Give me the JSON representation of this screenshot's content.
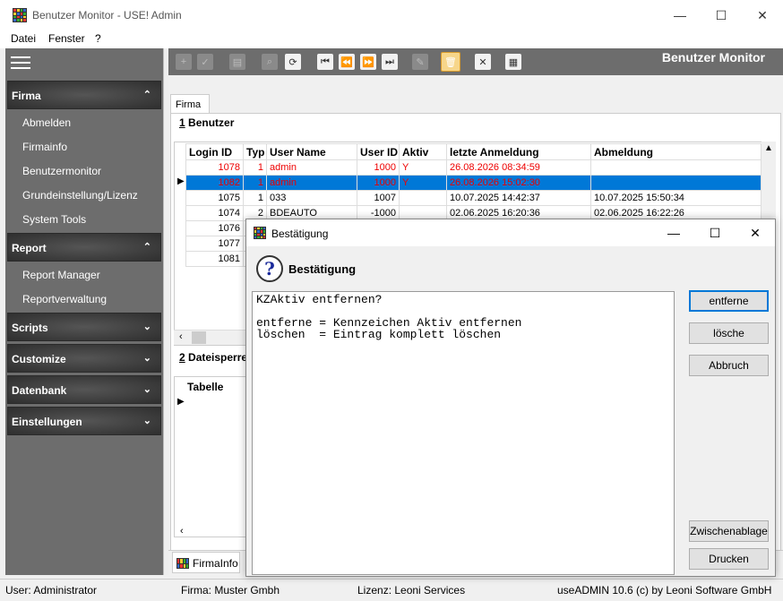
{
  "window": {
    "title": "Benutzer Monitor - USE! Admin",
    "min": "—",
    "max": "☐",
    "close": "✕"
  },
  "menu": [
    "Datei",
    "Fenster",
    "?"
  ],
  "sidebar": {
    "sections": [
      {
        "label": "Firma",
        "chev": "⌃",
        "items": [
          "Abmelden",
          "Firmainfo",
          "Benutzermonitor",
          "Grundeinstellung/Lizenz",
          "System Tools"
        ]
      },
      {
        "label": "Report",
        "chev": "⌃",
        "items": [
          "Report Manager",
          "Reportverwaltung"
        ]
      },
      {
        "label": "Scripts",
        "chev": "⌄",
        "items": []
      },
      {
        "label": "Customize",
        "chev": "⌄",
        "items": []
      },
      {
        "label": "Datenbank",
        "chev": "⌄",
        "items": []
      },
      {
        "label": "Einstellungen",
        "chev": "⌄",
        "items": []
      }
    ]
  },
  "toolbar": {
    "title": "Benutzer Monitor"
  },
  "tabs": {
    "firma": "Firma",
    "firmainfo": "FirmaInfo"
  },
  "group1": {
    "num": "1",
    "label": " Benutzer"
  },
  "group2": {
    "num": "2",
    "label": " Dateisperre"
  },
  "users": {
    "columns": [
      "Login ID",
      "Typ",
      "User Name",
      "User ID",
      "Aktiv",
      "letzte Anmeldung",
      "Abmeldung"
    ],
    "rows": [
      [
        "1078",
        "1",
        "admin",
        "1000",
        "Y",
        "26.08.2026 08:34:59",
        ""
      ],
      [
        "1082",
        "1",
        "admin",
        "1000",
        "Y",
        "26.08.2026 15:02:30",
        ""
      ],
      [
        "1075",
        "1",
        "033",
        "1007",
        "",
        "10.07.2025 14:42:37",
        "10.07.2025 15:50:34"
      ],
      [
        "1074",
        "2",
        "BDEAUTO",
        "-1000",
        "",
        "02.06.2025 16:20:36",
        "02.06.2025 16:22:26"
      ],
      [
        "1076",
        "",
        "",
        "",
        "",
        "",
        ""
      ],
      [
        "1077",
        "",
        "",
        "",
        "",
        "",
        ""
      ],
      [
        "1081",
        "",
        "",
        "",
        "",
        "",
        ""
      ]
    ]
  },
  "locks": {
    "columns": [
      "Tabelle"
    ]
  },
  "status": {
    "user": "User: Administrator",
    "firma": "Firma: Muster Gmbh",
    "lizenz": "Lizenz: Leoni Services",
    "version": "useADMIN 10.6 (c) by Leoni Software GmbH"
  },
  "dialog": {
    "title": "Bestätigung",
    "heading": "Bestätigung",
    "message": "KZAktiv entfernen?\n\nentferne = Kennzeichen Aktiv entfernen\nlöschen  = Eintrag komplett löschen",
    "buttons": {
      "entferne": "entferne",
      "losche": "lösche",
      "abbruch": "Abbruch",
      "zwischenablage": "Zwischenablage",
      "drucken": "Drucken"
    }
  }
}
